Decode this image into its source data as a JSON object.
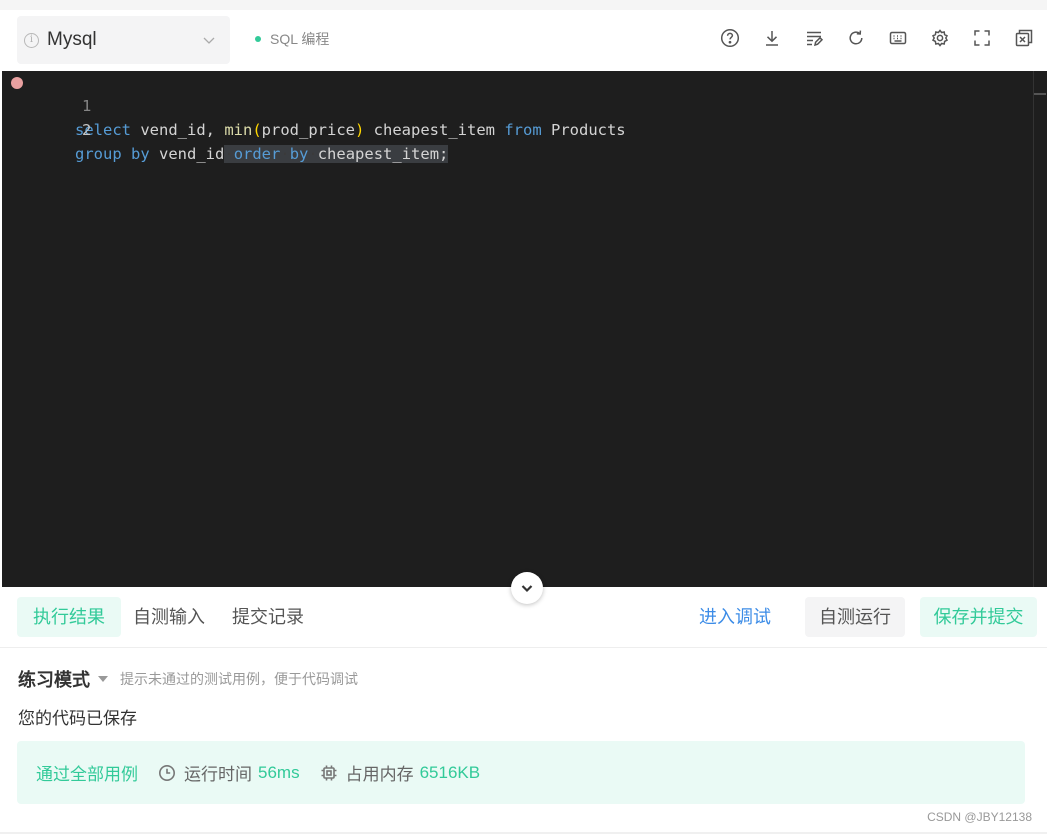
{
  "toolbar": {
    "language": "Mysql",
    "mode_tag": "SQL 编程",
    "icons": [
      "help-icon",
      "download-icon",
      "format-icon",
      "refresh-icon",
      "keyboard-icon",
      "settings-icon",
      "fullscreen-icon",
      "close-window-icon"
    ]
  },
  "editor": {
    "lines": [
      {
        "number": "1",
        "text": "select vend_id, min(prod_price) cheapest_item from Products"
      },
      {
        "number": "2",
        "text": "group by vend_id order by cheapest_item;"
      }
    ],
    "tokens": {
      "l1_select": "select",
      "l1_a": " vend_id, ",
      "l1_min": "min",
      "l1_po": "(",
      "l1_arg": "prod_price",
      "l1_pc": ")",
      "l1_b": " cheapest_item ",
      "l1_from": "from",
      "l1_c": " Products",
      "l2_group": "group",
      "l2_s1": " ",
      "l2_by": "by",
      "l2_a": " vend_id",
      "l2_d1": "·",
      "l2_order": "order",
      "l2_d2": "·",
      "l2_by2": "by",
      "l2_d3": "·",
      "l2_b": "cheapest_item;"
    }
  },
  "tabs": {
    "result": "执行结果",
    "custom_input": "自测输入",
    "submit_history": "提交记录"
  },
  "actions": {
    "debug": "进入调试",
    "self_test": "自测运行",
    "save_submit": "保存并提交"
  },
  "results": {
    "mode_title": "练习模式",
    "mode_hint": "提示未通过的测试用例，便于代码调试",
    "saved_msg": "您的代码已保存",
    "pass_label": "通过全部用例",
    "runtime_label": "运行时间",
    "runtime_value": "56ms",
    "memory_label": "占用内存",
    "memory_value": "6516KB"
  },
  "watermark": "CSDN @JBY12138",
  "colors": {
    "accent_green": "#32ca99",
    "link_blue": "#3c8ce7",
    "editor_bg": "#1e1e1e",
    "keyword": "#569cd6",
    "function": "#dcdcaa"
  }
}
